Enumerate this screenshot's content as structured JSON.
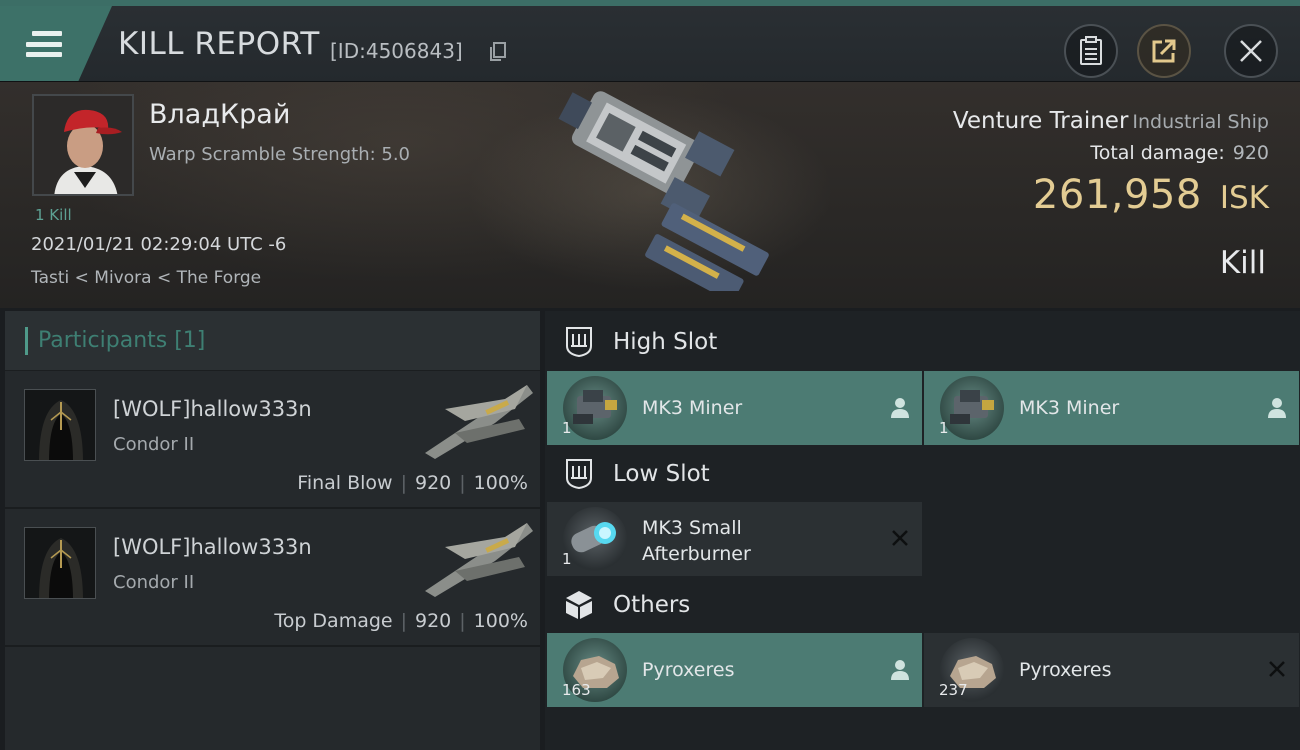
{
  "header": {
    "title": "KILL REPORT",
    "report_id": "[ID:4506843]",
    "icons": [
      "menu-icon",
      "copy-icon",
      "clipboard-icon",
      "share-icon",
      "close-icon"
    ]
  },
  "victim": {
    "name": "ВладКрай",
    "warp_scramble": "Warp Scramble Strength: 5.0",
    "kills": "1 Kill",
    "timestamp": "2021/01/21 02:29:04 UTC -6",
    "location": "Tasti < Mivora < The Forge",
    "ship_name": "Venture Trainer",
    "ship_class": "Industrial Ship",
    "total_damage_label": "Total damage:",
    "total_damage_value": "920",
    "isk_value": "261,958",
    "isk_unit": "ISK",
    "result": "Kill"
  },
  "participants": {
    "heading": "Participants [1]",
    "rows": [
      {
        "name": "[WOLF]hallow333n",
        "ship": "Condor II",
        "label": "Final Blow",
        "damage": "920",
        "percent": "100%"
      },
      {
        "name": "[WOLF]hallow333n",
        "ship": "Condor II",
        "label": "Top Damage",
        "damage": "920",
        "percent": "100%"
      }
    ]
  },
  "fitting": {
    "high_slot": {
      "label": "High Slot",
      "items": [
        {
          "name": "MK3 Miner",
          "qty": "1",
          "state": "owned",
          "icon": "pilot-icon"
        },
        {
          "name": "MK3 Miner",
          "qty": "1",
          "state": "owned",
          "icon": "pilot-icon"
        }
      ]
    },
    "low_slot": {
      "label": "Low Slot",
      "items": [
        {
          "name_line1": "MK3 Small",
          "name_line2": "Afterburner",
          "qty": "1",
          "state": "destroyed",
          "icon": "destroyed-x-icon"
        }
      ]
    },
    "others": {
      "label": "Others",
      "items": [
        {
          "name": "Pyroxeres",
          "qty": "163",
          "state": "owned",
          "icon": "pilot-icon"
        },
        {
          "name": "Pyroxeres",
          "qty": "237",
          "state": "destroyed",
          "icon": "destroyed-x-icon"
        }
      ]
    }
  },
  "colors": {
    "accent_teal": "#4c7b73",
    "isk_gold": "#e3cc93",
    "kills_green": "#5da193"
  }
}
